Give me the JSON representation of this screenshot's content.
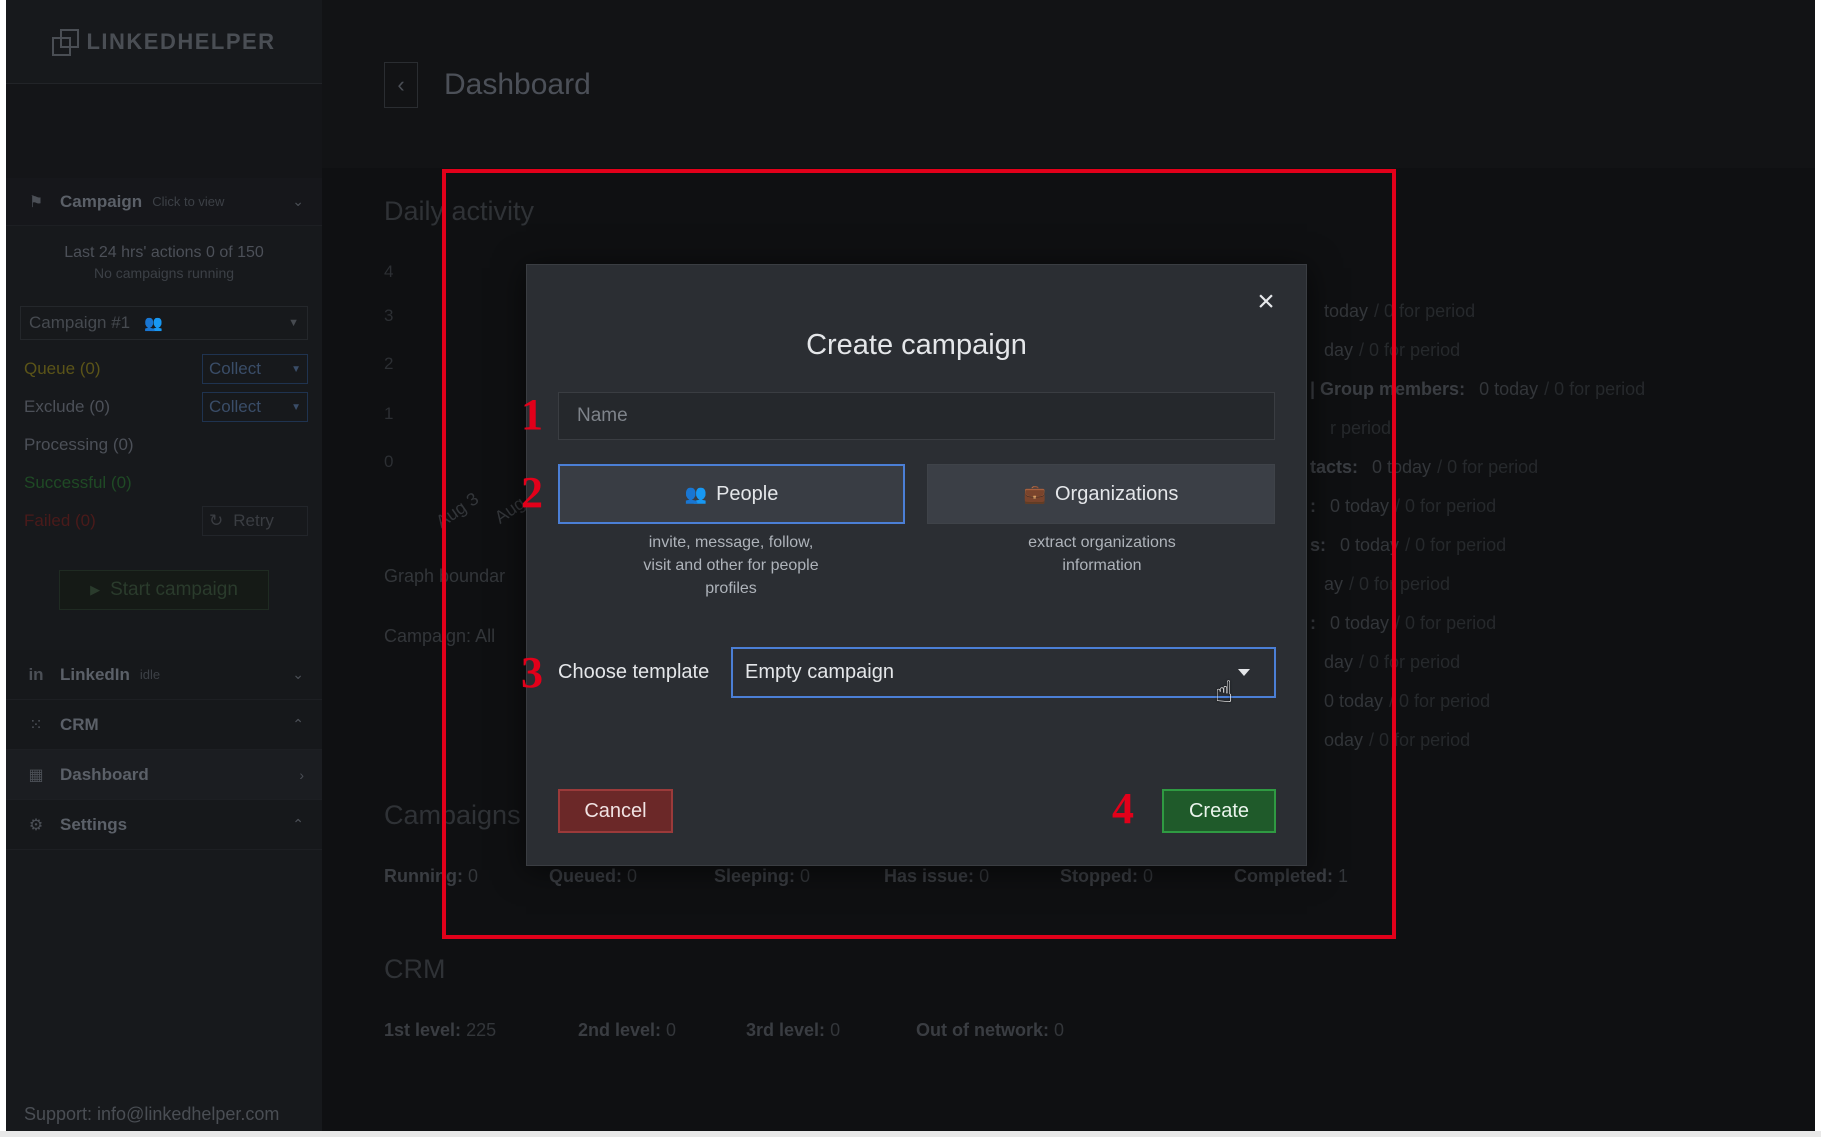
{
  "app": {
    "logo_text": "LINKEDHELPER"
  },
  "sidebar": {
    "campaign_section": {
      "title": "Campaign",
      "hint": "Click to view"
    },
    "stats_line": "Last 24 hrs' actions 0 of 150",
    "stats_sub": "No campaigns running",
    "campaign_select": "Campaign #1",
    "rows": [
      {
        "label": "Queue (0)",
        "color": "#5b5418",
        "button": "Collect"
      },
      {
        "label": "Exclude (0)",
        "color": "#4c5058",
        "button": "Collect"
      },
      {
        "label": "Processing (0)",
        "color": "#4c5058"
      },
      {
        "label": "Successful (0)",
        "color": "#1f4a25"
      },
      {
        "label": "Failed (0)",
        "color": "#4a1a1a",
        "button": "Retry"
      }
    ],
    "start_button": "Start campaign",
    "nav": [
      {
        "icon": "linkedin-icon",
        "label": "LinkedIn",
        "hint": "idle"
      },
      {
        "icon": "crm-grid-icon",
        "label": "CRM"
      },
      {
        "icon": "dashboard-icon",
        "label": "Dashboard"
      },
      {
        "icon": "gear-icon",
        "label": "Settings"
      }
    ],
    "support": "Support: info@linkedhelper.com"
  },
  "main": {
    "title": "Dashboard",
    "daily_activity": "Daily activity",
    "y_ticks": [
      "4",
      "3",
      "2",
      "1",
      "0"
    ],
    "x_ticks": [
      "Aug 3",
      "Aug"
    ],
    "graph_boundary": "Graph boundar",
    "campaign_filter_label": "Campaign:",
    "campaign_filter_value": "All",
    "activity_rows": [
      {
        "label": "",
        "today": "today",
        "period": "/ 0 for period"
      },
      {
        "label": "",
        "today": "day",
        "period": "/ 0 for period"
      },
      {
        "label": "| Group members:",
        "today": "0 today",
        "period": "/ 0 for period"
      },
      {
        "label": "",
        "today": "",
        "period": "r period"
      },
      {
        "label": "tacts:",
        "today": "0 today",
        "period": "/ 0 for period"
      },
      {
        "label": ":",
        "today": "0 today",
        "period": "/ 0 for period"
      },
      {
        "label": "s:",
        "today": "0 today",
        "period": "/ 0 for period"
      },
      {
        "label": "",
        "today": "ay",
        "period": "/ 0 for period"
      },
      {
        "label": ":",
        "today": "0 today",
        "period": "/ 0 for period"
      },
      {
        "label": "",
        "today": "day",
        "period": "/ 0 for period"
      },
      {
        "label": "",
        "today": "0 today",
        "period": "/ 0 for period"
      },
      {
        "label": "",
        "today": "oday",
        "period": "/ 0 for period"
      }
    ],
    "campaigns_heading": "Campaigns",
    "campaign_stats": [
      {
        "label": "Running:",
        "value": "0"
      },
      {
        "label": "Queued:",
        "value": "0"
      },
      {
        "label": "Sleeping:",
        "value": "0"
      },
      {
        "label": "Has issue:",
        "value": "0"
      },
      {
        "label": "Stopped:",
        "value": "0"
      },
      {
        "label": "Completed:",
        "value": "1"
      }
    ],
    "crm_heading": "CRM",
    "crm_stats": [
      {
        "label": "1st level:",
        "value": "225"
      },
      {
        "label": "2nd level:",
        "value": "0"
      },
      {
        "label": "3rd level:",
        "value": "0"
      },
      {
        "label": "Out of network:",
        "value": "0"
      }
    ]
  },
  "dialog": {
    "title": "Create campaign",
    "name_placeholder": "Name",
    "types": [
      {
        "label": "People",
        "icon": "people-icon",
        "description": "invite, message, follow, visit and other for people profiles"
      },
      {
        "label": "Organizations",
        "icon": "briefcase-icon",
        "description": "extract organizations information"
      }
    ],
    "template_label": "Choose template",
    "template_value": "Empty campaign",
    "cancel": "Cancel",
    "create": "Create"
  },
  "annotations": {
    "steps": [
      "1",
      "2",
      "3",
      "4"
    ],
    "frame_color": "#e2001a"
  }
}
